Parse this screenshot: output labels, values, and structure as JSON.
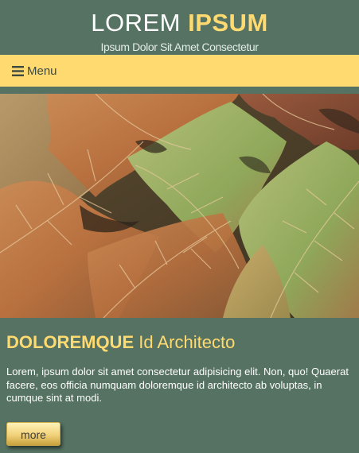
{
  "header": {
    "title_main": "LOREM",
    "title_accent": "IPSUM",
    "tagline": "Ipsum Dolor Sit Amet Consectetur"
  },
  "nav": {
    "menu_icon": "hamburger-icon",
    "menu_label": "Menu"
  },
  "hero": {
    "image_subject": "autumn oak leaves"
  },
  "article": {
    "title_strong": "DOLOREMQUE",
    "title_rest": "Id Architecto",
    "body": "Lorem, ipsum dolor sit amet consectetur adipisicing elit. Non, quo! Quaerat facere, eos officia numquam doloremque id architecto ab voluptas, in cumque sint at modi.",
    "more_label": "more"
  },
  "colors": {
    "background": "#557262",
    "accent": "#ffda70",
    "text": "#ffffff"
  }
}
